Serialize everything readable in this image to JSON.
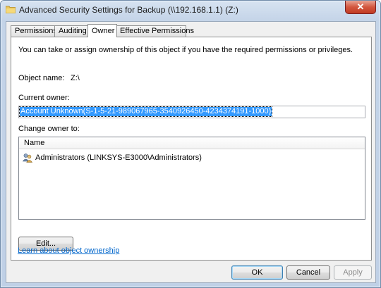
{
  "window": {
    "title": "Advanced Security Settings for Backup (\\\\192.168.1.1) (Z:)",
    "close_label": "✕"
  },
  "tabs": [
    {
      "label": "Permissions"
    },
    {
      "label": "Auditing"
    },
    {
      "label": "Owner",
      "active": true
    },
    {
      "label": "Effective Permissions"
    }
  ],
  "owner_tab": {
    "intro_text": "You can take or assign ownership of this object if you have the required permissions or privileges.",
    "object_name_label": "Object name:",
    "object_name_value": "Z:\\",
    "current_owner_label": "Current owner:",
    "current_owner_value": "Account Unknown(S-1-5-21-989067965-3540926450-4234374191-1000)",
    "change_owner_label": "Change owner to:",
    "list_header": "Name",
    "owners": [
      {
        "name": "Administrators (LINKSYS-E3000\\Administrators)",
        "icon": "user-group-icon"
      }
    ],
    "edit_button": "Edit...",
    "learn_link": "Learn about object ownership"
  },
  "footer": {
    "ok_label": "OK",
    "cancel_label": "Cancel",
    "apply_label": "Apply"
  },
  "colors": {
    "selection": "#3399ff",
    "link": "#0066cc",
    "close_button": "#c13a22"
  }
}
